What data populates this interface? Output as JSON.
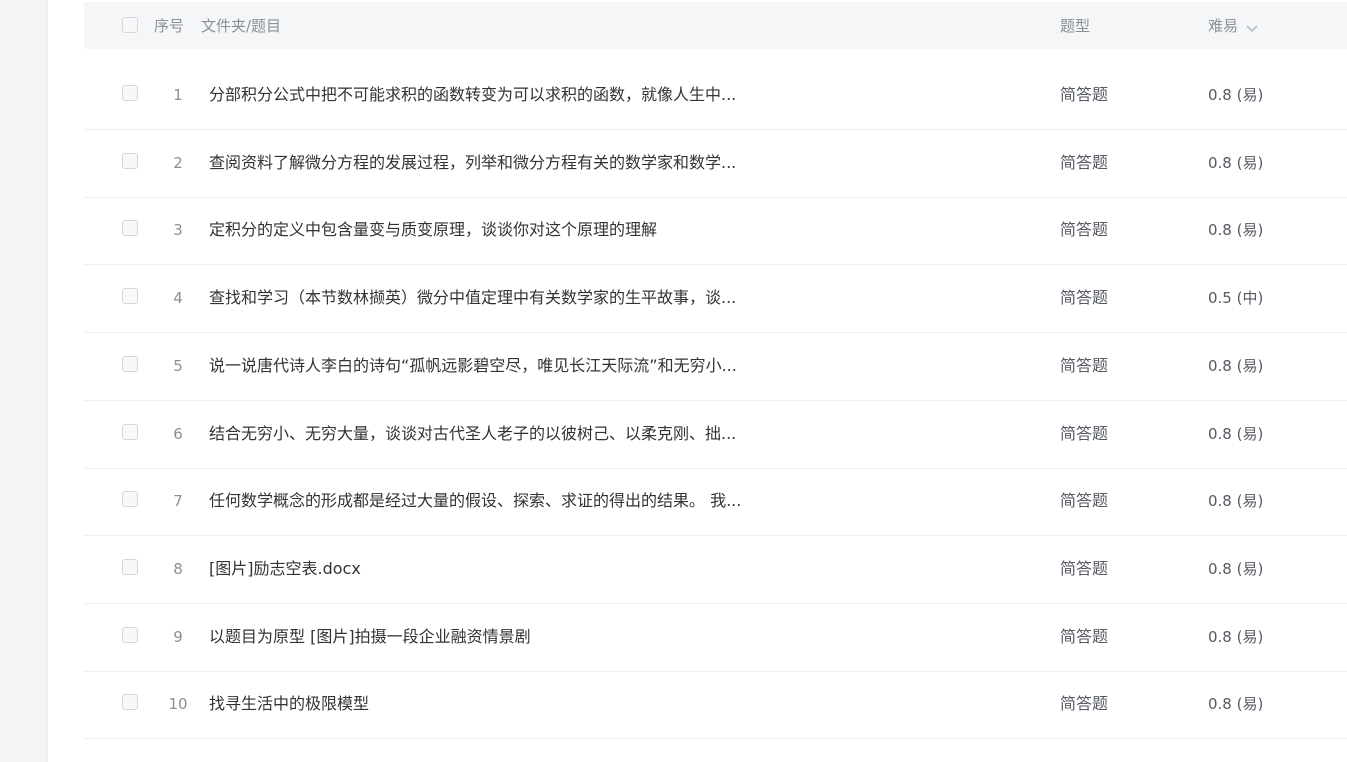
{
  "header": {
    "index_label": "序号",
    "title_label": "文件夹/题目",
    "type_label": "题型",
    "difficulty_label": "难易",
    "sort_icon": "chevron-down-icon"
  },
  "rows": [
    {
      "index": "1",
      "title": "分部积分公式中把不可能求积的函数转变为可以求积的函数，就像人生中...",
      "type": "简答题",
      "difficulty": "0.8 (易)"
    },
    {
      "index": "2",
      "title": "查阅资料了解微分方程的发展过程，列举和微分方程有关的数学家和数学...",
      "type": "简答题",
      "difficulty": "0.8 (易)"
    },
    {
      "index": "3",
      "title": "定积分的定义中包含量变与质变原理，谈谈你对这个原理的理解",
      "type": "简答题",
      "difficulty": "0.8 (易)"
    },
    {
      "index": "4",
      "title": "查找和学习（本节数林撷英）微分中值定理中有关数学家的生平故事，谈...",
      "type": "简答题",
      "difficulty": "0.5 (中)"
    },
    {
      "index": "5",
      "title": "说一说唐代诗人李白的诗句“孤帆远影碧空尽，唯见长江天际流”和无穷小...",
      "type": "简答题",
      "difficulty": "0.8 (易)"
    },
    {
      "index": "6",
      "title": "结合无穷小、无穷大量，谈谈对古代圣人老子的以彼树己、以柔克刚、拙...",
      "type": "简答题",
      "difficulty": "0.8 (易)"
    },
    {
      "index": "7",
      "title": "任何数学概念的形成都是经过大量的假设、探索、求证的得出的结果。 我...",
      "type": "简答题",
      "difficulty": "0.8 (易)"
    },
    {
      "index": "8",
      "title": "[图片]励志空表.docx",
      "type": "简答题",
      "difficulty": "0.8 (易)"
    },
    {
      "index": "9",
      "title": "以题目为原型 [图片]拍摄一段企业融资情景剧",
      "type": "简答题",
      "difficulty": "0.8 (易)"
    },
    {
      "index": "10",
      "title": "找寻生活中的极限模型",
      "type": "简答题",
      "difficulty": "0.8 (易)"
    }
  ]
}
